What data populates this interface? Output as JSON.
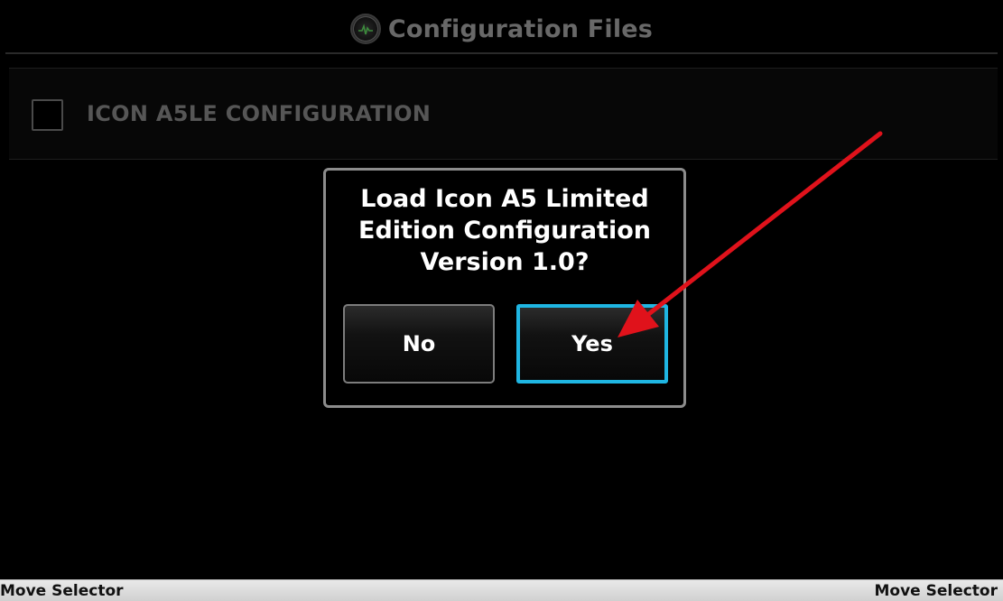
{
  "header": {
    "title": "Configuration Files",
    "icon": "gauge-icon"
  },
  "config_list": {
    "items": [
      {
        "label": "ICON A5LE CONFIGURATION",
        "checked": false
      }
    ]
  },
  "dialog": {
    "message": "Load Icon A5 Limited\nEdition Configuration\nVersion 1.0?",
    "no_label": "No",
    "yes_label": "Yes",
    "selected": "Yes"
  },
  "softkeys": {
    "left_label": "Move Selector",
    "right_label": "Move Selector"
  },
  "colors": {
    "background": "#000000",
    "selection_highlight": "#1fb6e3",
    "annotation_arrow": "#e0121b",
    "softkey_bar": "#d8d8d8"
  }
}
